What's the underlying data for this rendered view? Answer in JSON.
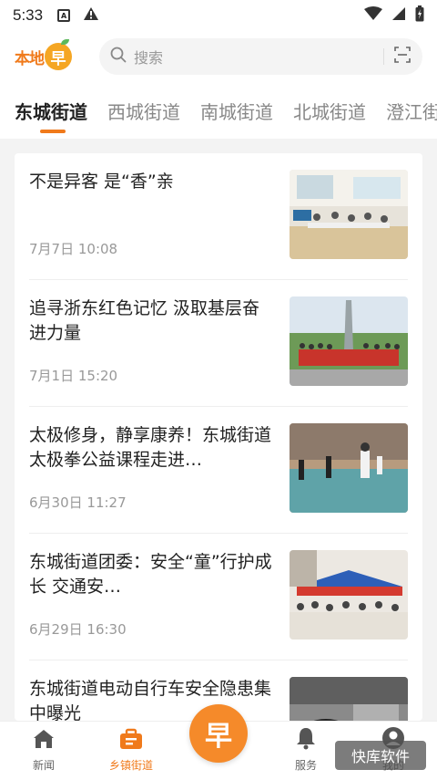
{
  "status_bar": {
    "time": "5:33",
    "box_icon_letter": "A"
  },
  "header": {
    "logo_text": "本地",
    "logo_badge": "早",
    "search_placeholder": "搜索"
  },
  "tabs": [
    {
      "label": "东城街道",
      "active": true
    },
    {
      "label": "西城街道",
      "active": false
    },
    {
      "label": "南城街道",
      "active": false
    },
    {
      "label": "北城街道",
      "active": false
    },
    {
      "label": "澄江街",
      "active": false
    }
  ],
  "news": [
    {
      "title": "不是异客 是“香”亲",
      "date": "7月7日  10:08",
      "thumb": "classroom"
    },
    {
      "title": "追寻浙东红色记忆 汲取基层奋进力量",
      "date": "7月1日  15:20",
      "thumb": "monument"
    },
    {
      "title": "太极修身，静享康养！东城街道太极拳公益课程走进…",
      "date": "6月30日  11:27",
      "thumb": "taichi"
    },
    {
      "title": "东城街道团委：安全“童”行护成长 交通安…",
      "date": "6月29日  16:30",
      "thumb": "tent"
    },
    {
      "title": "东城街道电动自行车安全隐患集中曝光",
      "date": "",
      "thumb": "scooter"
    }
  ],
  "bottom_nav": {
    "items": [
      {
        "label": "新闻",
        "icon": "home-icon",
        "active": false
      },
      {
        "label": "乡镇街道",
        "icon": "briefcase-icon",
        "active": true
      },
      {
        "label": "服务",
        "icon": "bell-icon",
        "active": false
      },
      {
        "label": "我的",
        "icon": "user-icon",
        "active": false
      }
    ],
    "center_label": "早"
  },
  "watermark": "快库软件",
  "colors": {
    "accent": "#f07a1b",
    "tab_inactive": "#888888"
  }
}
